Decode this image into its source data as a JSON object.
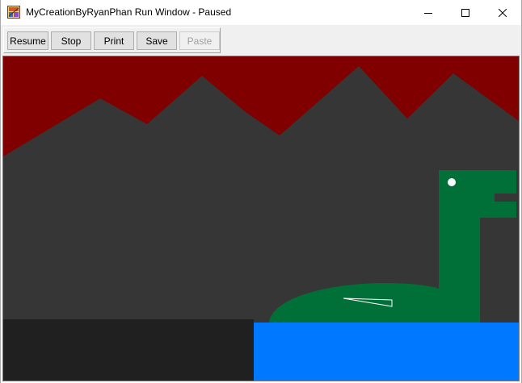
{
  "window": {
    "title": "MyCreationByRyanPhan Run Window - Paused"
  },
  "toolbar": {
    "buttons": [
      {
        "label": "Resume",
        "enabled": true
      },
      {
        "label": "Stop",
        "enabled": true
      },
      {
        "label": "Print",
        "enabled": true
      },
      {
        "label": "Save",
        "enabled": true
      },
      {
        "label": "Paste",
        "enabled": false
      }
    ]
  },
  "scene": {
    "colors": {
      "sky": "#800000",
      "mountains": "#363636",
      "ground": "#202020",
      "water": "#0078ff",
      "dinosaur": "#007038",
      "eye": "#ffffff",
      "fin_outline": "#ffffff"
    }
  }
}
